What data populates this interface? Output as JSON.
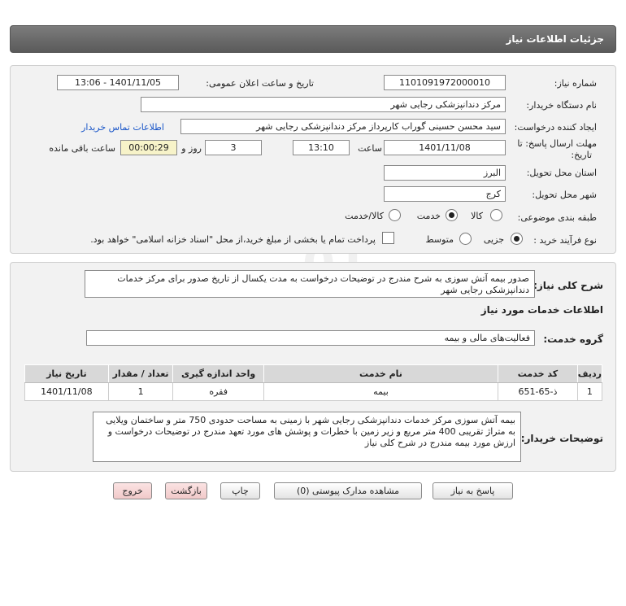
{
  "header": {
    "title": "جزئیات اطلاعات نیاز"
  },
  "fields": {
    "need_number_label": "شماره نیاز:",
    "need_number": "1101091972000010",
    "announce_label": "تاریخ و ساعت اعلان عمومی:",
    "announce_value": "1401/11/05 - 13:06",
    "buyer_org_label": "نام دستگاه خریدار:",
    "buyer_org": "مرکز دندانپزشکی رجایی شهر",
    "requester_label": "ایجاد کننده درخواست:",
    "requester": "سید محسن  حسینی گوراب کارپرداز مرکز دندانپزشکی رجایی شهر",
    "contact_link": "اطلاعات تماس خریدار",
    "deadline_label_1": "مهلت ارسال پاسخ: تا",
    "deadline_label_2": "تاریخ:",
    "deadline_date": "1401/11/08",
    "time_label": "ساعت",
    "deadline_time": "13:10",
    "days": "3",
    "days_label": "روز و",
    "remaining_time": "00:00:29",
    "remaining_label": "ساعت باقی مانده",
    "province_label": "استان محل تحویل:",
    "province": "البرز",
    "city_label": "شهر محل تحویل:",
    "city": "کرج",
    "category_label": "طبقه بندی موضوعی:",
    "category_options": [
      "کالا",
      "خدمت",
      "کالا/خدمت"
    ],
    "process_label": "نوع فرآیند خرید :",
    "process_options": [
      "جزیی",
      "متوسط"
    ],
    "payment_note": "پرداخت تمام یا بخشی از مبلغ خرید،از محل \"اسناد خزانه اسلامی\" خواهد بود."
  },
  "summary": {
    "label": "شرح کلی نیاز:",
    "text": "صدور بیمه آتش سوزی به شرح مندرج در توضیحات درخواست به مدت یکسال از تاریخ صدور برای مرکز خدمات دندانپزشکی رجایی شهر",
    "services_heading": "اطلاعات خدمات مورد نیاز",
    "group_label": "گروه خدمت:",
    "group_value": "فعالیت‌های مالی و بیمه"
  },
  "table": {
    "headers": [
      "ردیف",
      "کد خدمت",
      "نام خدمت",
      "واحد اندازه گیری",
      "تعداد / مقدار",
      "تاریخ نیاز"
    ],
    "rows": [
      [
        "1",
        "ذ-65-651",
        "بیمه",
        "فقره",
        "1",
        "1401/11/08"
      ]
    ]
  },
  "buyer_notes": {
    "label": "توضیحات خریدار:",
    "text": "بیمه آتش سوزی مرکز خدمات دندانپزشکی رجایی شهر با زمینی به مساحت حدودی 750 متر و ساختمان ویلایی به متراژ تقریبی 400 متر مربع و زیر زمین با خطرات و پوشش های مورد تعهد مندرج در توضیحات درخواست و ارزش مورد بیمه مندرج در شرح کلی نیاز"
  },
  "buttons": {
    "reply": "پاسخ به نیاز",
    "attachments": "مشاهده مدارک پیوستی (0)",
    "print": "چاپ",
    "back": "بازگشت",
    "exit": "خروج"
  }
}
